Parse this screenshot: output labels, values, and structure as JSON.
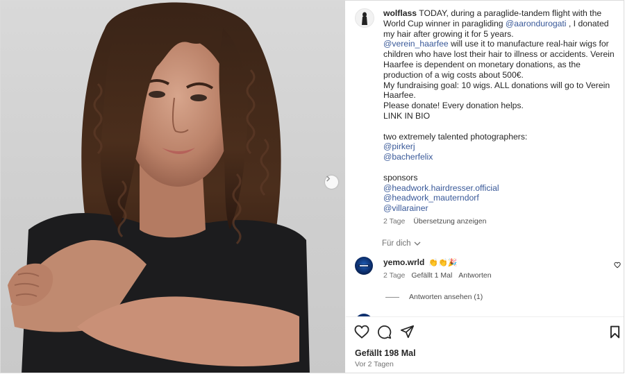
{
  "post": {
    "author": "wolflass",
    "caption_lines": [
      {
        "type": "lead",
        "parts": [
          {
            "text": "TODAY, during a paraglide-tandem flight with the World Cup winner in paragliding "
          },
          {
            "text": "@aarondurogati",
            "mention": true
          },
          {
            "text": " , I donated my hair after growing it for 5 years."
          }
        ]
      },
      {
        "type": "line",
        "parts": [
          {
            "text": "@verein_haarfee",
            "mention": true
          },
          {
            "text": " will use it to manufacture real-hair wigs for children who have lost their hair to illness or accidents. Verein Haarfee is dependent on monetary donations, as the production of a wig costs about 500€."
          }
        ]
      },
      {
        "type": "line",
        "parts": [
          {
            "text": "My fundraising goal: 10 wigs. ALL donations will go to Verein Haarfee."
          }
        ]
      },
      {
        "type": "line",
        "parts": [
          {
            "text": "Please donate! Every donation helps."
          }
        ]
      },
      {
        "type": "line",
        "parts": [
          {
            "text": "LINK IN BIO"
          }
        ]
      },
      {
        "type": "blank"
      },
      {
        "type": "line",
        "parts": [
          {
            "text": "two extremely talented photographers:"
          }
        ]
      },
      {
        "type": "line",
        "parts": [
          {
            "text": "@pirkerj",
            "mention": true
          }
        ]
      },
      {
        "type": "line",
        "parts": [
          {
            "text": "@bacherfelix",
            "mention": true
          }
        ]
      },
      {
        "type": "blank"
      },
      {
        "type": "line",
        "parts": [
          {
            "text": "sponsors"
          }
        ]
      },
      {
        "type": "line",
        "parts": [
          {
            "text": "@headwork.hairdresser.official",
            "mention": true
          }
        ]
      },
      {
        "type": "line",
        "parts": [
          {
            "text": "@headwork_mauterndorf",
            "mention": true
          }
        ]
      },
      {
        "type": "line",
        "parts": [
          {
            "text": "@villarainer",
            "mention": true
          }
        ]
      }
    ],
    "caption_age": "2 Tage",
    "translate_label": "Übersetzung anzeigen"
  },
  "for_you": {
    "label": "Für dich",
    "icon": "chevron-down-icon"
  },
  "comment": {
    "user": "yemo.wrld",
    "emojis": "👏👏🎉",
    "age": "2 Tage",
    "likes": "Gefällt 1 Mal",
    "reply_label": "Antworten",
    "view_replies": "Antworten ansehen (1)"
  },
  "footer": {
    "likes": "Gefällt 198 Mal",
    "date": "Vor 2 Tagen"
  },
  "icons": {
    "like": "heart-icon",
    "comment": "comment-bubble-icon",
    "share": "paper-plane-icon",
    "save": "bookmark-icon",
    "next": "chevron-right-icon"
  },
  "colors": {
    "mention": "#385898",
    "text": "#262626",
    "secondary": "#737373",
    "border": "#dbdbdb"
  }
}
